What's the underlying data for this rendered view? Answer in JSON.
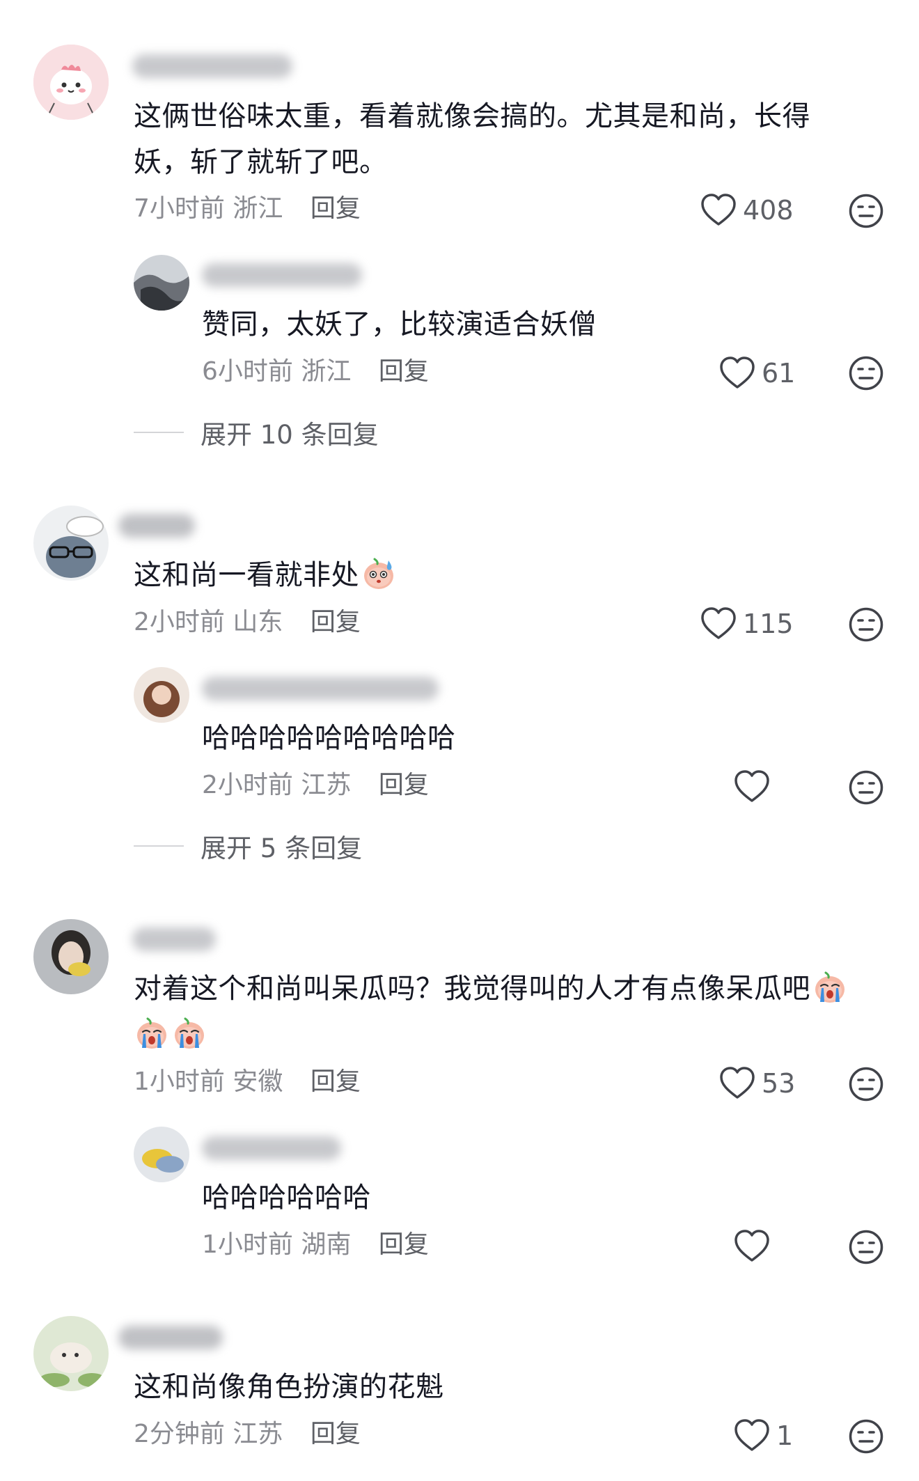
{
  "comments": [
    {
      "text": "这俩世俗味太重，看着就像会搞的。尤其是和尚，长得妖，斩了就斩了吧。",
      "time": "7小时前",
      "location": "浙江",
      "reply_label": "回复",
      "likes": "408",
      "replies": [
        {
          "text": "赞同，太妖了，比较演适合妖僧",
          "time": "6小时前",
          "location": "浙江",
          "reply_label": "回复",
          "likes": "61"
        }
      ],
      "expand_label": "展开 10 条回复"
    },
    {
      "text": "这和尚一看就非处",
      "time": "2小时前",
      "location": "山东",
      "reply_label": "回复",
      "likes": "115",
      "replies": [
        {
          "text": "哈哈哈哈哈哈哈哈哈",
          "time": "2小时前",
          "location": "江苏",
          "reply_label": "回复",
          "likes": ""
        }
      ],
      "expand_label": "展开 5 条回复"
    },
    {
      "text": "对着这个和尚叫呆瓜吗？我觉得叫的人才有点像呆瓜吧",
      "time": "1小时前",
      "location": "安徽",
      "reply_label": "回复",
      "likes": "53",
      "replies": [
        {
          "text": "哈哈哈哈哈哈",
          "time": "1小时前",
          "location": "湖南",
          "reply_label": "回复",
          "likes": ""
        }
      ]
    },
    {
      "text": "这和尚像角色扮演的花魁",
      "time": "2分钟前",
      "location": "江苏",
      "reply_label": "回复",
      "likes": "1"
    }
  ],
  "icons": {
    "like": "heart-outline-icon",
    "dislike": "neutral-face-icon",
    "emoji_sweat": "sweating-face-emoji",
    "emoji_cry": "crying-face-emoji"
  },
  "colors": {
    "text": "#161823",
    "meta": "#8a8b91",
    "secondary": "#5e6066",
    "icon": "#404249"
  }
}
